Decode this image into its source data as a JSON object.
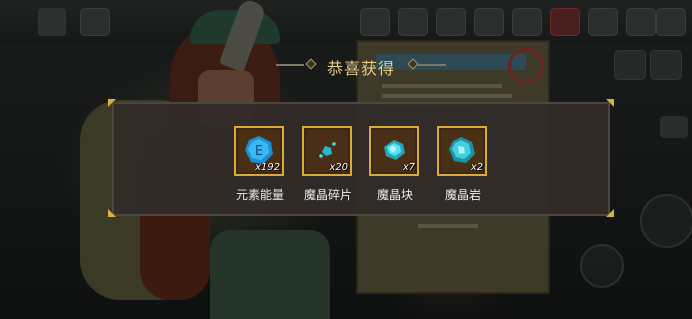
{
  "dialog": {
    "title": "恭喜获得",
    "rewards": [
      {
        "name": "元素能量",
        "quantity": "x192",
        "icon": "element-energy-icon"
      },
      {
        "name": "魔晶碎片",
        "quantity": "x20",
        "icon": "magic-crystal-shard-icon"
      },
      {
        "name": "魔晶块",
        "quantity": "x7",
        "icon": "magic-crystal-chunk-icon"
      },
      {
        "name": "魔晶岩",
        "quantity": "x2",
        "icon": "magic-crystal-rock-icon"
      }
    ]
  },
  "colors": {
    "title": "#e8cd8a",
    "slot_border": "#d9aa35",
    "panel": "#322c28",
    "gem": "#2fc7e0"
  }
}
